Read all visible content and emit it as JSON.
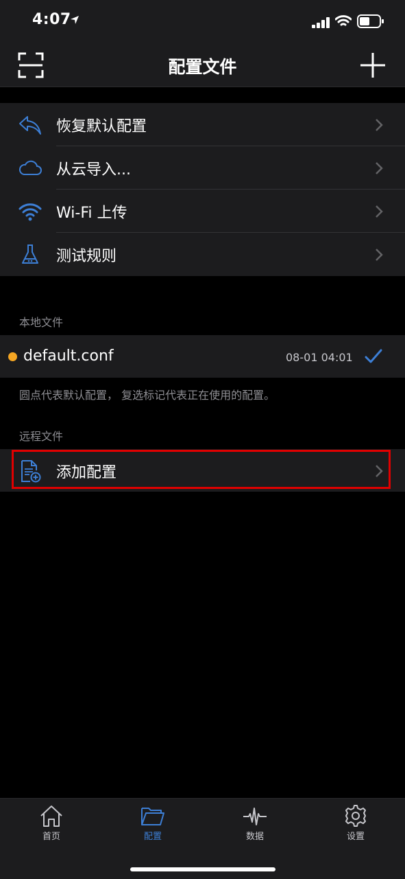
{
  "status_bar": {
    "time": "4:07"
  },
  "nav": {
    "title": "配置文件"
  },
  "menu": {
    "items": [
      {
        "label": "恢复默认配置",
        "icon": "reply-arrow-icon"
      },
      {
        "label": "从云导入...",
        "icon": "cloud-icon"
      },
      {
        "label": "Wi-Fi 上传",
        "icon": "wifi-icon"
      },
      {
        "label": "测试规则",
        "icon": "flask-icon"
      }
    ]
  },
  "local": {
    "header": "本地文件",
    "file": {
      "name": "default.conf",
      "date": "08-01 04:01"
    },
    "footnote": "圆点代表默认配置， 复选标记代表正在使用的配置。"
  },
  "remote": {
    "header": "远程文件",
    "add_label": "添加配置"
  },
  "tabs": [
    {
      "label": "首页",
      "icon": "home-icon",
      "active": false
    },
    {
      "label": "配置",
      "icon": "folder-icon",
      "active": true
    },
    {
      "label": "数据",
      "icon": "waveform-icon",
      "active": false
    },
    {
      "label": "设置",
      "icon": "gear-icon",
      "active": false
    }
  ],
  "colors": {
    "accent": "#3d7fd6",
    "background": "#000000",
    "cell": "#1c1c1e",
    "default_dot": "#f5a623",
    "highlight": "#e00000",
    "secondary_text": "#8e8e93"
  }
}
